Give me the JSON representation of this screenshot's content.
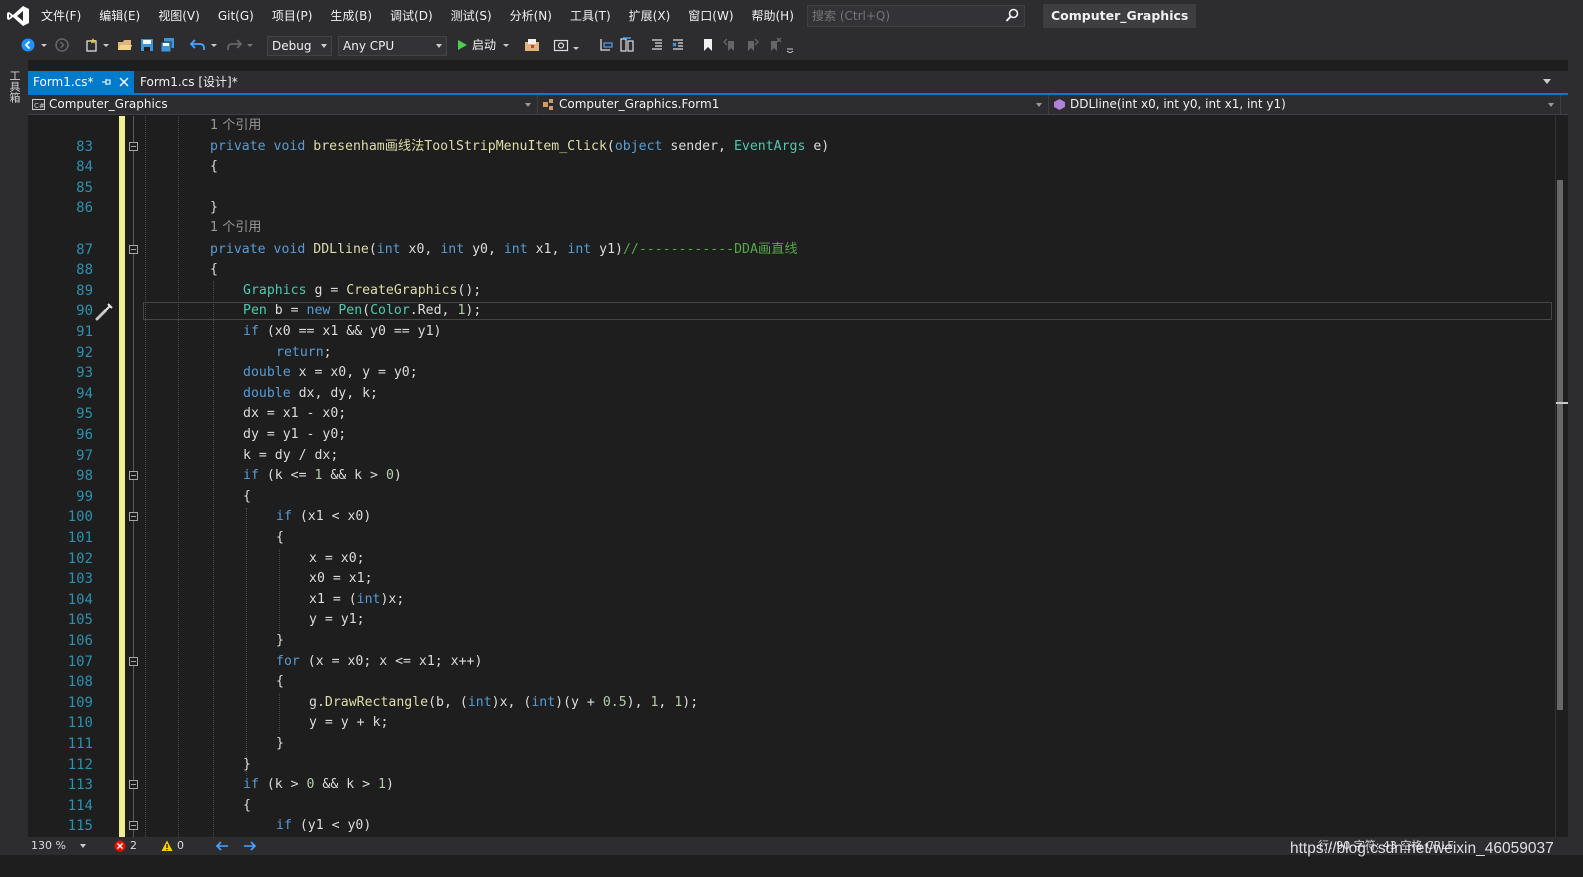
{
  "menu": {
    "items": [
      "文件(F)",
      "编辑(E)",
      "视图(V)",
      "Git(G)",
      "项目(P)",
      "生成(B)",
      "调试(D)",
      "测试(S)",
      "分析(N)",
      "工具(T)",
      "扩展(X)",
      "窗口(W)",
      "帮助(H)"
    ],
    "search_placeholder": "搜索 (Ctrl+Q)",
    "solution_title": "Computer_Graphics"
  },
  "toolbar": {
    "config": "Debug",
    "platform": "Any CPU",
    "start_label": "启动"
  },
  "left_panel": {
    "toolbox_label": "工具箱"
  },
  "tabs": {
    "active": "Form1.cs*",
    "inactive": "Form1.cs [设计]*"
  },
  "navbar": {
    "project": "Computer_Graphics",
    "class": "Computer_Graphics.Form1",
    "member": "DDLline(int x0, int y0, int x1, int y1)"
  },
  "editor": {
    "codelens_text": "1 个引用",
    "lines": [
      {
        "n": "83",
        "indent": 0
      },
      {
        "n": "84",
        "indent": 0
      },
      {
        "n": "85",
        "indent": 0
      },
      {
        "n": "86",
        "indent": 0
      },
      {
        "n": "87",
        "indent": 0
      },
      {
        "n": "88",
        "indent": 0
      },
      {
        "n": "89",
        "indent": 1
      },
      {
        "n": "90",
        "indent": 1
      },
      {
        "n": "91",
        "indent": 1
      },
      {
        "n": "92",
        "indent": 2
      },
      {
        "n": "93",
        "indent": 1
      },
      {
        "n": "94",
        "indent": 1
      },
      {
        "n": "95",
        "indent": 1
      },
      {
        "n": "96",
        "indent": 1
      },
      {
        "n": "97",
        "indent": 1
      },
      {
        "n": "98",
        "indent": 1
      },
      {
        "n": "99",
        "indent": 1
      },
      {
        "n": "100",
        "indent": 2
      },
      {
        "n": "101",
        "indent": 2
      },
      {
        "n": "102",
        "indent": 3
      },
      {
        "n": "103",
        "indent": 3
      },
      {
        "n": "104",
        "indent": 3
      },
      {
        "n": "105",
        "indent": 3
      },
      {
        "n": "106",
        "indent": 2
      },
      {
        "n": "107",
        "indent": 2
      },
      {
        "n": "108",
        "indent": 2
      },
      {
        "n": "109",
        "indent": 3
      },
      {
        "n": "110",
        "indent": 3
      },
      {
        "n": "111",
        "indent": 2
      },
      {
        "n": "112",
        "indent": 1
      },
      {
        "n": "113",
        "indent": 1
      },
      {
        "n": "114",
        "indent": 1
      },
      {
        "n": "115",
        "indent": 2
      }
    ],
    "code": {
      "l83": [
        "private",
        "void",
        "bresenham画线法ToolStripMenuItem_Click",
        "(",
        "object",
        " sender, ",
        "EventArgs",
        " e)"
      ],
      "l84": "{",
      "l86": "}",
      "l87": [
        "private",
        "void",
        "DDLline",
        "(",
        "int",
        " x0, ",
        "int",
        " y0, ",
        "int",
        " x1, ",
        "int",
        " y1)",
        "//------------DDA画直线"
      ],
      "l88": "{",
      "l89": [
        "Graphics",
        " g = ",
        "CreateGraphics",
        "();"
      ],
      "l90": [
        "Pen",
        " b = ",
        "new",
        "Pen",
        "(",
        "Color",
        ".Red, ",
        "1",
        ");"
      ],
      "l91": [
        "if",
        " (x0 == x1 && y0 == y1)"
      ],
      "l92": [
        "return",
        ";"
      ],
      "l93": [
        "double",
        " x = x0, y = y0;"
      ],
      "l94": [
        "double",
        " dx, dy, k;"
      ],
      "l95": "dx = x1 - x0;",
      "l96": "dy = y1 - y0;",
      "l97": "k = dy / dx;",
      "l98": [
        "if",
        " (k <= ",
        "1",
        " && k > ",
        "0",
        ")"
      ],
      "l99": "{",
      "l100": [
        "if",
        " (x1 < x0)"
      ],
      "l101": "{",
      "l102": "x = x0;",
      "l103": "x0 = x1;",
      "l104": [
        "x1 = (",
        "int",
        ")x;"
      ],
      "l105": "y = y1;",
      "l106": "}",
      "l107": [
        "for",
        " (x = x0; x <= x1; x++)"
      ],
      "l108": "{",
      "l109": [
        "g.",
        "DrawRectangle",
        "(b, (",
        "int",
        ")x, (",
        "int",
        ")(y + ",
        "0.5",
        "), ",
        "1",
        ", ",
        "1",
        ");"
      ],
      "l110": "y = y + k;",
      "l111": "}",
      "l112": "}",
      "l113": [
        "if",
        " (k > ",
        "0",
        " && k > ",
        "1",
        ")"
      ],
      "l114": "{",
      "l115": [
        "if",
        " (y1 < y0)"
      ]
    }
  },
  "status": {
    "zoom": "130 %",
    "errors": "2",
    "warnings": "0",
    "position": "行: 90    字符: 43    空格    CRLF"
  },
  "watermark": "https://blog.csdn.net/weixin_46059037"
}
